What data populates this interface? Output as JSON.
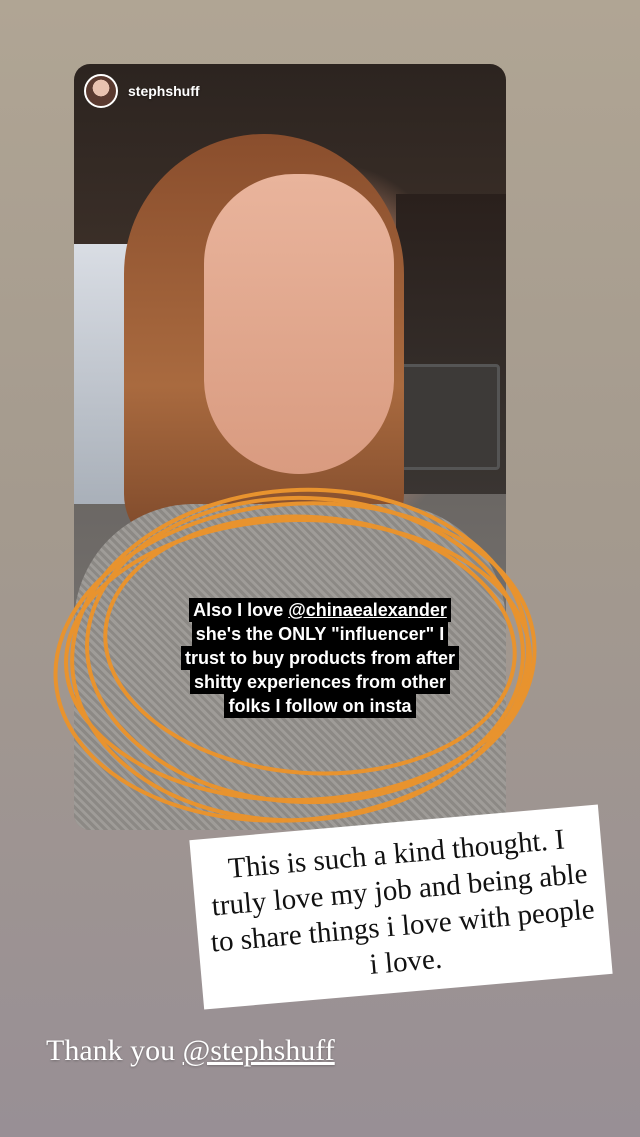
{
  "story": {
    "username": "stephshuff",
    "caption_lines": [
      "Also I love ",
      "@chinaealexander",
      "she's the ONLY \"influencer\" I",
      "trust to buy products from after",
      "shitty experiences from other",
      "folks I follow on insta"
    ]
  },
  "note": {
    "text": "This is such a kind thought. I truly love my job and being able to share things i love with people i love."
  },
  "thanks": {
    "prefix": "Thank you ",
    "mention": "@stephshuff"
  },
  "colors": {
    "scribble": "#e8932e",
    "caption_bg": "#000000",
    "note_bg": "#ffffff"
  }
}
